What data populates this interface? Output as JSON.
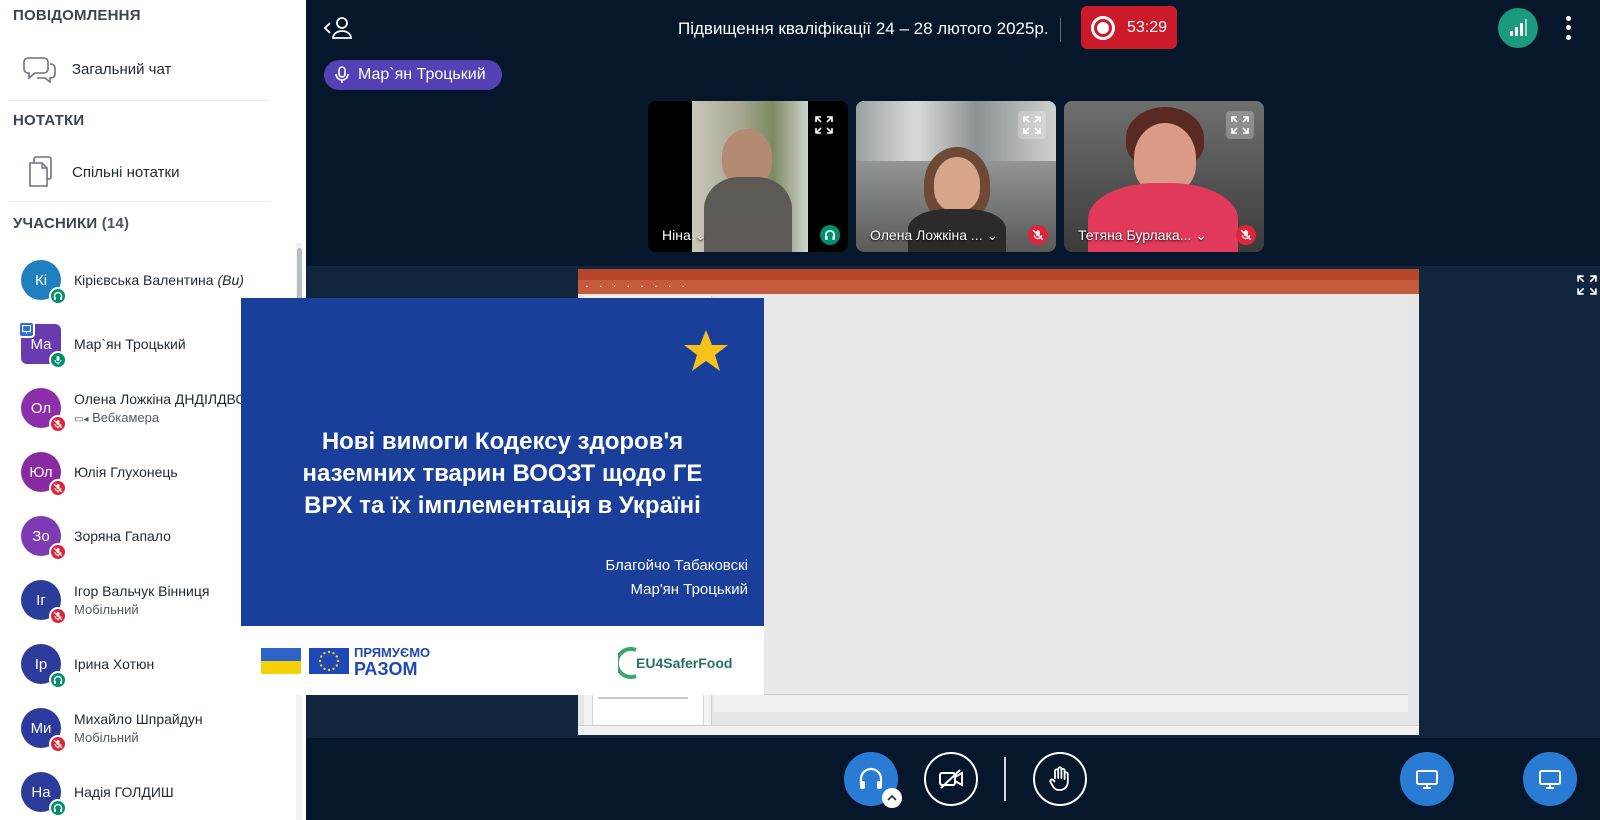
{
  "sidebar": {
    "messages_title": "ПОВІДОМЛЕННЯ",
    "public_chat": "Загальний чат",
    "notes_title": "НОТАТКИ",
    "shared_notes": "Спільні нотатки",
    "users_title": "УЧАСНИКИ",
    "users_count": "(14)"
  },
  "participants": [
    {
      "initials": "Кі",
      "name": "Кірієвська Валентина",
      "you_label": "(Ви)",
      "sub": "",
      "color": "#1f7fc1",
      "status": "listen",
      "presenter": false
    },
    {
      "initials": "Ма",
      "name": "Мар`ян Троцький",
      "sub": "",
      "color": "#6a3ab0",
      "status": "mic-on",
      "presenter": true
    },
    {
      "initials": "Ол",
      "name": "Олена Ложкіна ДНДІЛДВСЕ",
      "sub": "Вебкамера",
      "color": "#8c2ea9",
      "status": "muted",
      "presenter": false
    },
    {
      "initials": "Юл",
      "name": "Юлія Глухонець",
      "sub": "",
      "color": "#8a2aa3",
      "status": "muted",
      "presenter": false
    },
    {
      "initials": "Зо",
      "name": "Зоряна Гапало",
      "sub": "",
      "color": "#7d3ab3",
      "status": "muted",
      "presenter": false
    },
    {
      "initials": "Іг",
      "name": "Ігор Вальчук Вінниця",
      "sub": "Мобільний",
      "color": "#2a3d9a",
      "status": "muted",
      "presenter": false
    },
    {
      "initials": "Ір",
      "name": "Ірина Хотюн",
      "sub": "",
      "color": "#2d3c9c",
      "status": "listen",
      "presenter": false
    },
    {
      "initials": "Ми",
      "name": "Михайло Шпрайдун",
      "sub": "Мобільний",
      "color": "#2c3a9e",
      "status": "muted",
      "presenter": false
    },
    {
      "initials": "На",
      "name": "Надія ГОЛДИШ",
      "sub": "",
      "color": "#2a3b9a",
      "status": "listen",
      "presenter": false
    }
  ],
  "header": {
    "title": "Підвищення кваліфікації 24 – 28 лютого 2025р.",
    "rec_time": "53:29"
  },
  "talking": {
    "name": "Мар`ян Троцький"
  },
  "videos": [
    {
      "name": "Ніна",
      "mic": "listen"
    },
    {
      "name": "Олена Ложкіна ...",
      "mic": "muted"
    },
    {
      "name": "Тетяна Бурлака...",
      "mic": "muted"
    }
  ],
  "slide": {
    "title_line1": "Нові вимоги Кодексу здоров'я",
    "title_line2": "наземних тварин ВООЗТ щодо ГЕ",
    "title_line3": "ВРХ та їх імплементація в Україні",
    "author1": "Благойчо Табаковскі",
    "author2": "Мар'ян Троцький",
    "brand_line1": "ПРЯМУЄМО",
    "brand_line2": "РАЗОМ",
    "partner": "EU4SaferFood"
  },
  "colors": {
    "background": "#06172b",
    "record": "#cd1a2a",
    "accent_blue": "#2a7bd4",
    "talker": "#5441b5",
    "mic_on": "#00906b",
    "muted": "#e0243a",
    "slide_blue": "#1a3f9b"
  },
  "icons": [
    "chat-icon",
    "notes-icon",
    "headphones-icon",
    "mic-icon",
    "mic-muted-icon",
    "record-icon",
    "connection-icon",
    "more-icon",
    "expand-icon",
    "camera-off-icon",
    "hand-icon",
    "screenshare-icon",
    "presentation-icon"
  ]
}
